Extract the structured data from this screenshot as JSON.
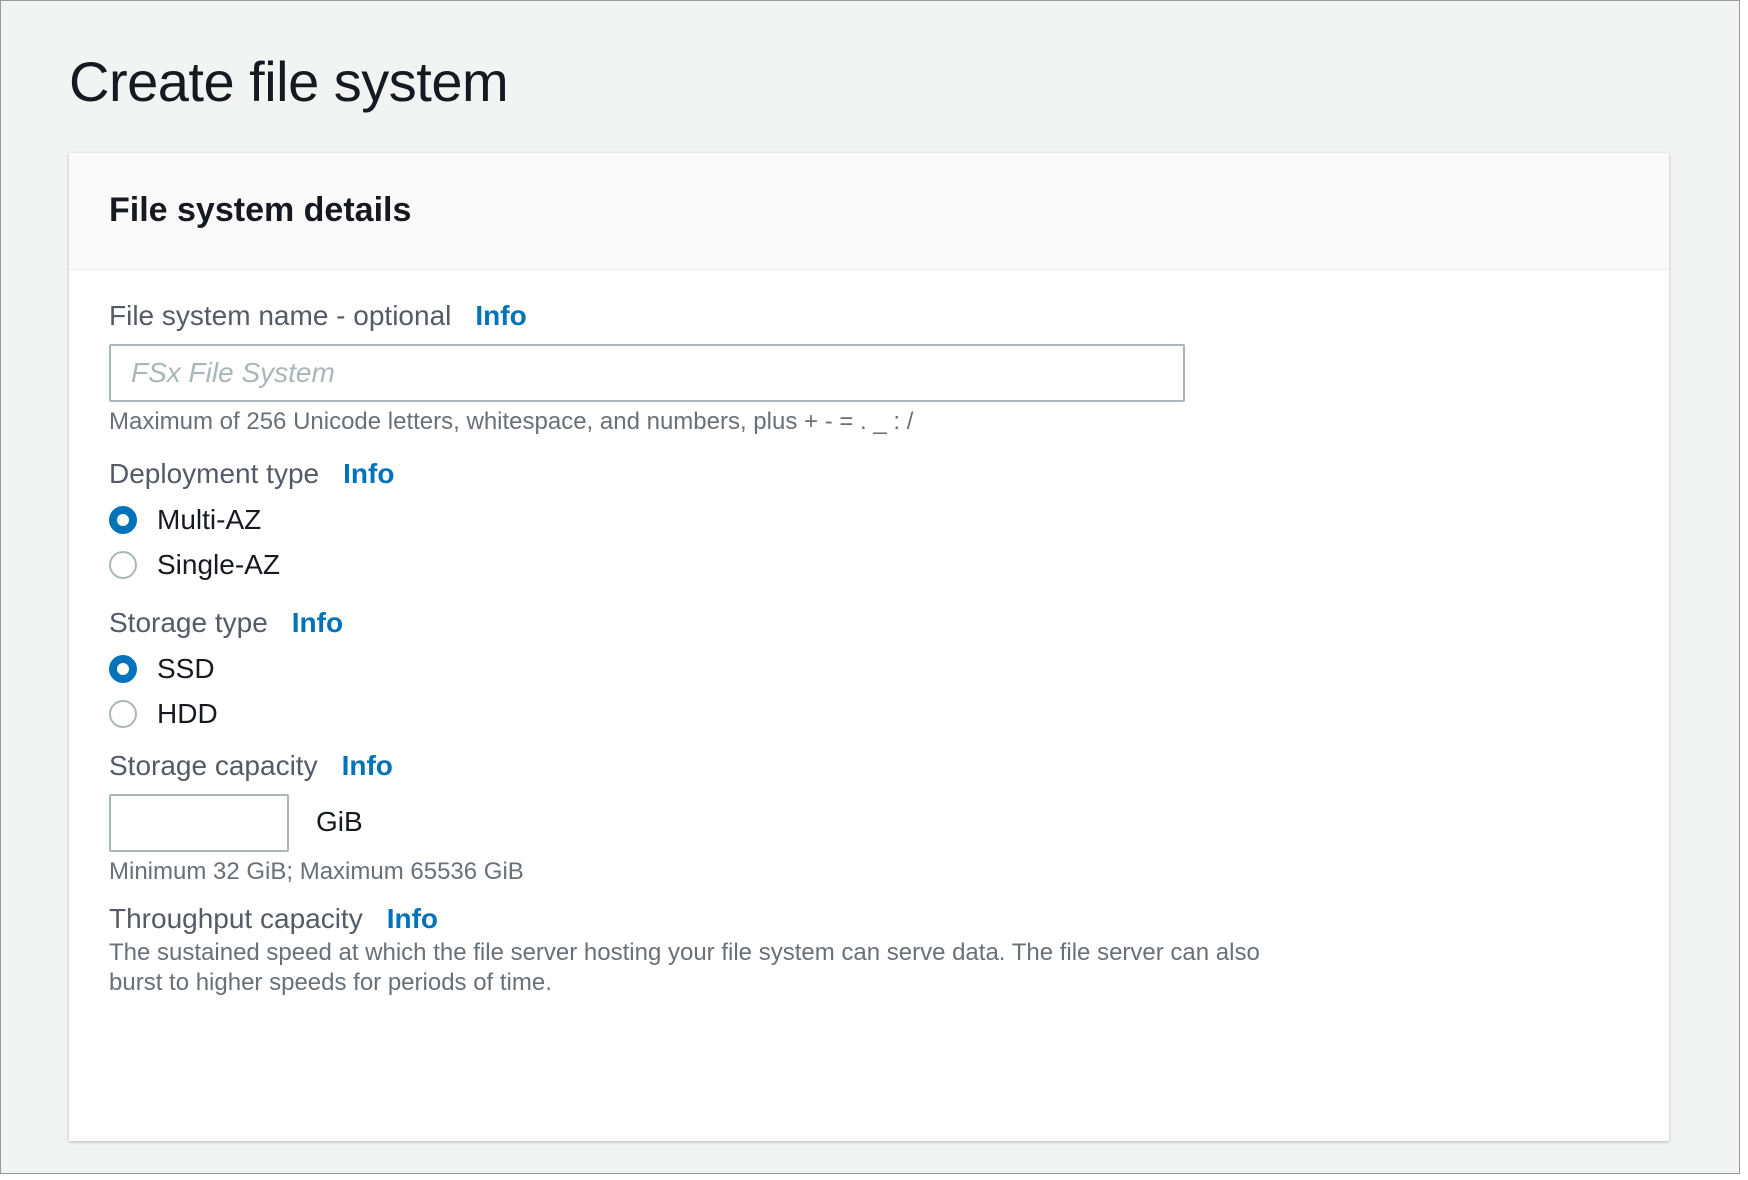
{
  "page": {
    "title": "Create file system"
  },
  "panel": {
    "title": "File system details"
  },
  "fields": {
    "name": {
      "label": "File system name - optional",
      "info": "Info",
      "placeholder": "FSx File System",
      "value": "",
      "hint": "Maximum of 256 Unicode letters, whitespace, and numbers, plus + - = . _ : /"
    },
    "deployment": {
      "label": "Deployment type",
      "info": "Info",
      "options": [
        {
          "label": "Multi-AZ",
          "selected": true
        },
        {
          "label": "Single-AZ",
          "selected": false
        }
      ]
    },
    "storage_type": {
      "label": "Storage type",
      "info": "Info",
      "options": [
        {
          "label": "SSD",
          "selected": true
        },
        {
          "label": "HDD",
          "selected": false
        }
      ]
    },
    "storage_capacity": {
      "label": "Storage capacity",
      "info": "Info",
      "value": "",
      "unit": "GiB",
      "hint": "Minimum 32 GiB; Maximum 65536 GiB"
    },
    "throughput": {
      "label": "Throughput capacity",
      "info": "Info",
      "description": "The sustained speed at which the file server hosting your file system can serve data. The file server can also burst to higher speeds for periods of time."
    }
  },
  "colors": {
    "accent": "#0073bb",
    "page_bg": "#f2f3f3",
    "text": "#16191f",
    "muted": "#687078"
  }
}
